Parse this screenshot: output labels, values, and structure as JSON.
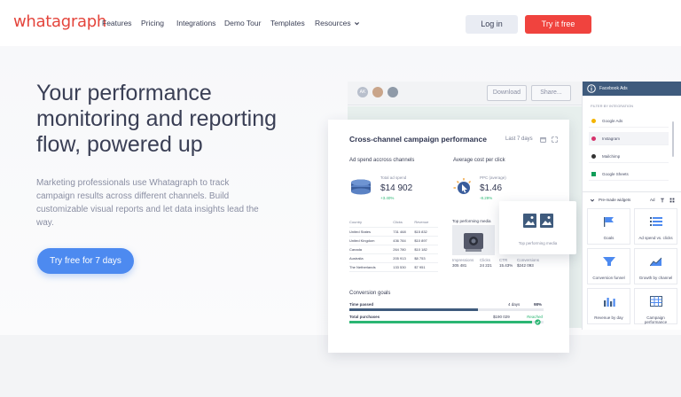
{
  "brand": {
    "logo": "whatagraph",
    "accent": "#f0433e",
    "primary": "#4d8af0"
  },
  "nav": {
    "links": [
      "Features",
      "Pricing",
      "Integrations",
      "Demo Tour",
      "Templates",
      "Resources"
    ],
    "login": "Log in",
    "try": "Try it free"
  },
  "hero": {
    "headline": "Your performance monitoring and reporting flow, powered up",
    "subtext": "Marketing professionals use Whatagraph to track campaign results across different channels. Build customizable visual reports and let data insights lead the way.",
    "cta": "Try free for 7 days"
  },
  "dashboard": {
    "download": "Download",
    "share": "Share...",
    "card_title": "Cross-channel campaign performance",
    "period": "Last 7 days",
    "ad_spend_title": "Ad spend accross channels",
    "total_label": "Total ad spend",
    "total_value": "$14 902",
    "total_delta": "+3.40%",
    "avg_cost_title": "Average cost per click",
    "ppc_label": "PPC (average)",
    "ppc_value": "$1.46",
    "ppc_delta": "-8.29%",
    "table": {
      "headers": [
        "Country",
        "Clicks",
        "Revenue"
      ],
      "rows": [
        [
          "United States",
          "731 468",
          "$15 832"
        ],
        [
          "United Kingdom",
          "436 784",
          "$10 897"
        ],
        [
          "Canada",
          "264 780",
          "$10 182"
        ],
        [
          "Australia",
          "205 913",
          "$8 753"
        ],
        [
          "The Netherlands",
          "133 530",
          "$7 951"
        ]
      ]
    },
    "top_media_title": "Top performing media",
    "media_stats": {
      "headers": [
        "Impressions",
        "Clicks",
        "CTR",
        "Conversions"
      ],
      "values": [
        "305 481",
        "24 221",
        "15.43%",
        "$242 093"
      ]
    },
    "tooltip_label": "Top performing media",
    "conversion_title": "Conversion goals",
    "time_passed_label": "Time passed",
    "time_passed_value": "4 days",
    "time_passed_pct": "98%",
    "purchases_label": "Total purchases",
    "purchases_value": "$190 029",
    "purchases_status": "Reached",
    "time_progress": 0.66,
    "purchase_progress": 0.94
  },
  "panel": {
    "header": "Facebook Ads",
    "filter_label": "FILTER BY INTEGRATION",
    "integrations": [
      "Google Ads",
      "Instagram",
      "Mailchimp",
      "Google Sheets"
    ],
    "widgets_label": "Pre-made widgets",
    "widgets_tag": "Ad",
    "widgets": [
      "Goals",
      "Ad spend vs. clicks",
      "Conversion funnel",
      "Growth by channel",
      "Revenue by day",
      "Campaign performance"
    ]
  }
}
